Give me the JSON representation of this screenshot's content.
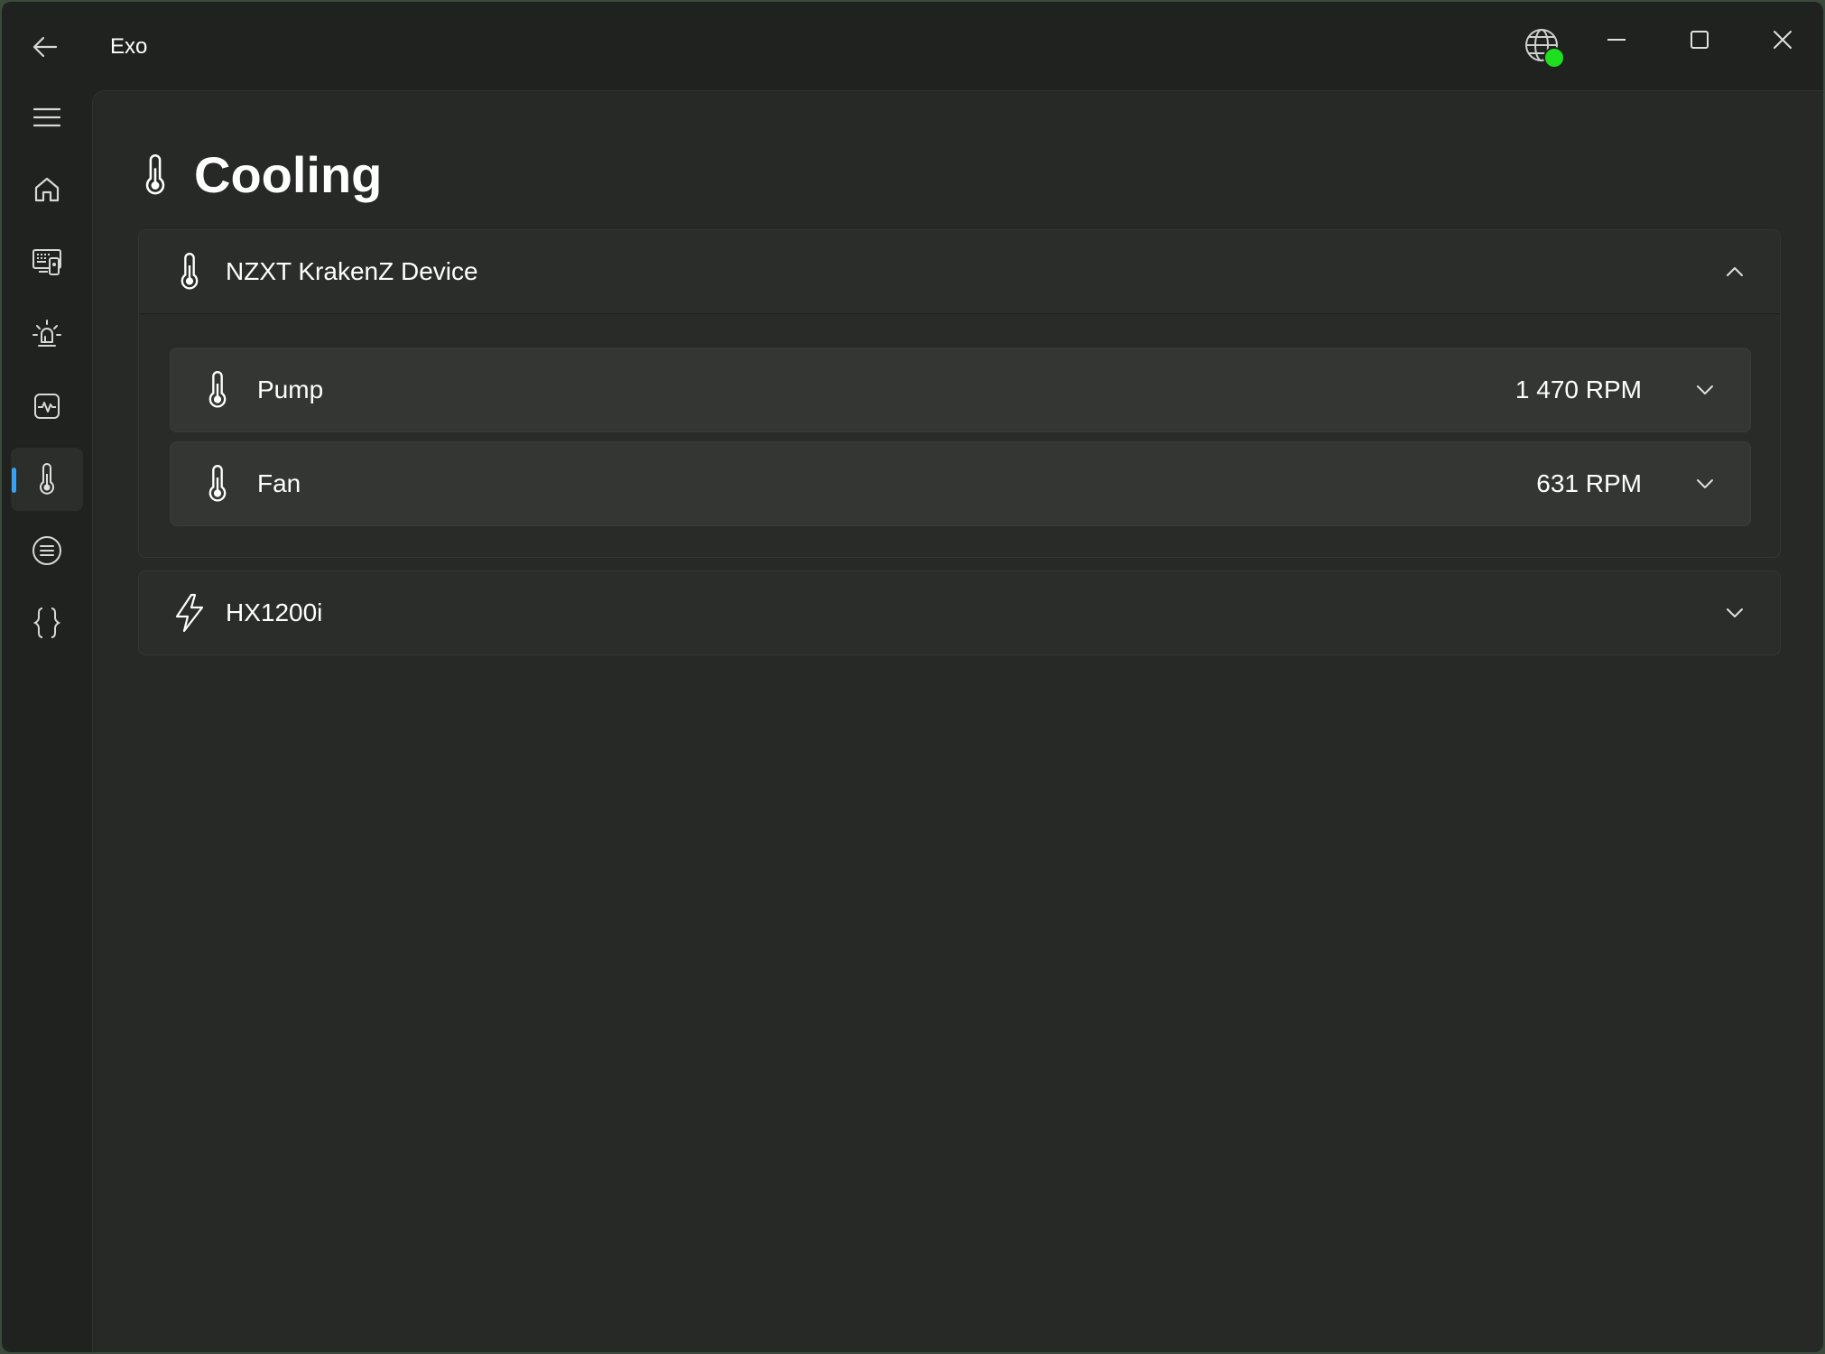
{
  "app": {
    "title": "Exo"
  },
  "status": {
    "icon": "globe-icon",
    "dot_color": "#1ee01e"
  },
  "window_controls": [
    "minimize-icon",
    "maximize-icon",
    "close-icon"
  ],
  "sidebar": {
    "items": [
      {
        "name": "menu",
        "icon": "hamburger-icon"
      },
      {
        "name": "home",
        "icon": "home-icon"
      },
      {
        "name": "devices",
        "icon": "devices-icon"
      },
      {
        "name": "lighting",
        "icon": "lightbulb-icon"
      },
      {
        "name": "monitoring",
        "icon": "activity-icon"
      },
      {
        "name": "cooling",
        "icon": "thermometer-icon",
        "selected": true
      },
      {
        "name": "list",
        "icon": "list-icon"
      },
      {
        "name": "programming",
        "icon": "braces-icon"
      }
    ],
    "accent": "#3aa0f0"
  },
  "page": {
    "title": "Cooling",
    "icon": "thermometer-icon"
  },
  "devices": [
    {
      "name": "NZXT KrakenZ Device",
      "icon": "thermometer-icon",
      "expanded": true,
      "coolers": [
        {
          "label": "Pump",
          "value": "1 470 RPM"
        },
        {
          "label": "Fan",
          "value": "631 RPM"
        }
      ]
    },
    {
      "name": "HX1200i",
      "icon": "lightning-icon",
      "expanded": false
    }
  ]
}
